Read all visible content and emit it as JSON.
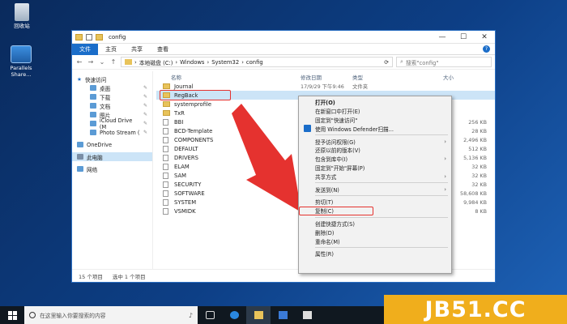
{
  "desktop": {
    "icons": [
      {
        "label": "回收站",
        "icon": "recycle-bin-icon"
      },
      {
        "label": "Parallels Share...",
        "icon": "parallels-share-icon"
      }
    ]
  },
  "window": {
    "title": "config",
    "controls": {
      "minimize": "—",
      "maximize": "☐",
      "close": "✕"
    },
    "ribbon_tabs": [
      "文件",
      "主页",
      "共享",
      "查看"
    ],
    "address": {
      "path": [
        "本地磁盘 (C:)",
        "Windows",
        "System32",
        "config"
      ],
      "separator": "›"
    },
    "search_placeholder": "搜索\"config\"",
    "sidebar": [
      {
        "label": "快速访问",
        "sub": false,
        "pin": false
      },
      {
        "label": "桌面",
        "sub": true,
        "pin": true
      },
      {
        "label": "下载",
        "sub": true,
        "pin": true
      },
      {
        "label": "文档",
        "sub": true,
        "pin": true
      },
      {
        "label": "图片",
        "sub": true,
        "pin": true
      },
      {
        "label": "iCloud Drive (M",
        "sub": true,
        "pin": true
      },
      {
        "label": "Photo Stream (",
        "sub": true,
        "pin": true
      },
      {
        "label": "OneDrive",
        "sub": false,
        "pin": false
      },
      {
        "label": "此电脑",
        "sub": false,
        "pin": false,
        "selected": true
      },
      {
        "label": "网络",
        "sub": false,
        "pin": false
      }
    ],
    "columns": {
      "name": "名称",
      "date": "修改日期",
      "type": "类型",
      "size": "大小"
    },
    "files": [
      {
        "name": "Journal",
        "kind": "folder",
        "date": "17/9/29 下午9:46",
        "type": "文件夹",
        "size": ""
      },
      {
        "name": "RegBack",
        "kind": "folder",
        "date": "",
        "type": "",
        "size": "",
        "selected": true
      },
      {
        "name": "systemprofile",
        "kind": "folder",
        "date": "",
        "type": "",
        "size": ""
      },
      {
        "name": "TxR",
        "kind": "folder",
        "date": "",
        "type": "",
        "size": ""
      },
      {
        "name": "BBI",
        "kind": "file",
        "date": "",
        "type": "",
        "size": "256 KB"
      },
      {
        "name": "BCD-Template",
        "kind": "file",
        "date": "",
        "type": "",
        "size": "28 KB"
      },
      {
        "name": "COMPONENTS",
        "kind": "file",
        "date": "",
        "type": "",
        "size": "2,496 KB"
      },
      {
        "name": "DEFAULT",
        "kind": "file",
        "date": "",
        "type": "",
        "size": "512 KB"
      },
      {
        "name": "DRIVERS",
        "kind": "file",
        "date": "",
        "type": "",
        "size": "5,136 KB"
      },
      {
        "name": "ELAM",
        "kind": "file",
        "date": "",
        "type": "",
        "size": "32 KB"
      },
      {
        "name": "SAM",
        "kind": "file",
        "date": "",
        "type": "",
        "size": "32 KB"
      },
      {
        "name": "SECURITY",
        "kind": "file",
        "date": "",
        "type": "",
        "size": "32 KB"
      },
      {
        "name": "SOFTWARE",
        "kind": "file",
        "date": "",
        "type": "",
        "size": "58,608 KB"
      },
      {
        "name": "SYSTEM",
        "kind": "file",
        "date": "",
        "type": "",
        "size": "9,984 KB"
      },
      {
        "name": "VSMIDK",
        "kind": "file",
        "date": "",
        "type": "",
        "size": "8 KB"
      }
    ],
    "status": {
      "count": "15 个项目",
      "selected": "选中 1 个项目"
    }
  },
  "context_menu": {
    "groups": [
      [
        {
          "label": "打开(O)",
          "bold": true
        },
        {
          "label": "在新窗口中打开(E)"
        },
        {
          "label": "固定到\"快速访问\""
        },
        {
          "label": "使用 Windows Defender扫描...",
          "icon": "defender-shield-icon"
        }
      ],
      [
        {
          "label": "授予访问权限(G)",
          "submenu": true
        },
        {
          "label": "还原以前的版本(V)"
        },
        {
          "label": "包含到库中(I)",
          "submenu": true
        },
        {
          "label": "固定到\"开始\"屏幕(P)"
        },
        {
          "label": "共享方式",
          "submenu": true
        }
      ],
      [
        {
          "label": "发送到(N)",
          "submenu": true
        }
      ],
      [
        {
          "label": "剪切(T)"
        },
        {
          "label": "复制(C)",
          "highlighted": true
        }
      ],
      [
        {
          "label": "创建快捷方式(S)"
        },
        {
          "label": "删除(D)"
        },
        {
          "label": "重命名(M)"
        }
      ],
      [
        {
          "label": "属性(R)"
        }
      ]
    ]
  },
  "taskbar": {
    "search_placeholder": "在这里输入你要搜索的内容",
    "icons": [
      "task-view-icon",
      "edge-icon",
      "file-explorer-icon",
      "store-icon",
      "mail-icon"
    ]
  },
  "watermark": "JB51.CC",
  "colors": {
    "accent": "#1a6dc9",
    "annotation_red": "#e5322f",
    "selection": "#cce4f7",
    "watermark_bg": "#f0ae1c"
  }
}
